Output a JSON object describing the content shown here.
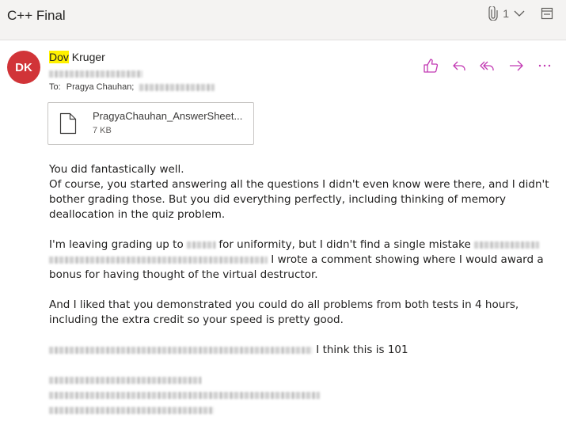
{
  "subject": "C++ Final",
  "attachment_count": "1",
  "sender": {
    "initials": "DK",
    "first": "Dov",
    "last": " Kruger"
  },
  "to_label": "To:",
  "recipient": "Pragya Chauhan;",
  "attachment": {
    "name": "PragyaChauhan_AnswerSheet...",
    "size": "7 KB"
  },
  "message": {
    "l1": "You did fantastically well.",
    "l2": "Of course, you started answering all the questions I didn't even know were there, and I didn't",
    "l3": "bother grading those. But you did everything perfectly, including thinking of memory",
    "l4": "deallocation in the quiz problem.",
    "l5a": "I'm leaving grading up to",
    "l5b": "for uniformity, but I didn't find a single mistake",
    "l6": "I wrote a comment showing where I would award  a",
    "l7": "bonus for having thought of the virtual destructor.",
    "l8": "And I liked that you demonstrated you could do all problems from both tests in 4 hours,",
    "l9": "including the extra credit so your speed is pretty good.",
    "l10": "I think this is 101"
  },
  "colors": {
    "avatar": "#d13438",
    "accent": "#c239b3",
    "highlight": "#fff100"
  },
  "icons": [
    "paperclip-icon",
    "chevron-down-icon",
    "popout-icon",
    "file-icon",
    "like-icon",
    "reply-icon",
    "reply-all-icon",
    "forward-icon",
    "more-icon"
  ]
}
